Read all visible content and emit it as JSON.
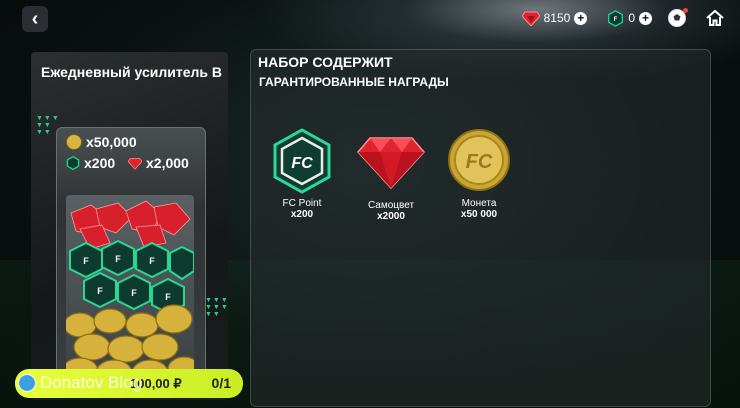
{
  "header": {
    "back_icon": "chevron-left-icon",
    "gems_value": "8150",
    "fc_points_value": "0",
    "icons": [
      "gem-icon",
      "fc-point-icon",
      "football-icon",
      "home-icon"
    ]
  },
  "pack": {
    "title": "Ежедневный усилитель B",
    "coins_label": "x50,000",
    "fc_label": "x200",
    "gems_label": "x2,000",
    "price_label": "100,00 ₽",
    "purchase_count": "0/1",
    "watermark": "Donatov Blog"
  },
  "panel": {
    "title": "НАБОР СОДЕРЖИТ",
    "subtitle": "ГАРАНТИРОВАННЫЕ НАГРАДЫ",
    "rewards": [
      {
        "name": "FC Point",
        "qty": "x200",
        "icon": "fc-point-icon"
      },
      {
        "name": "Самоцвет",
        "qty": "x2000",
        "icon": "gem-icon"
      },
      {
        "name": "Монета",
        "qty": "x50 000",
        "icon": "coin-icon"
      }
    ]
  },
  "colors": {
    "accent_green": "#20d08a",
    "gem_red": "#e0242f",
    "coin_gold": "#d7b640",
    "buy_bar": "#d8f52e"
  }
}
